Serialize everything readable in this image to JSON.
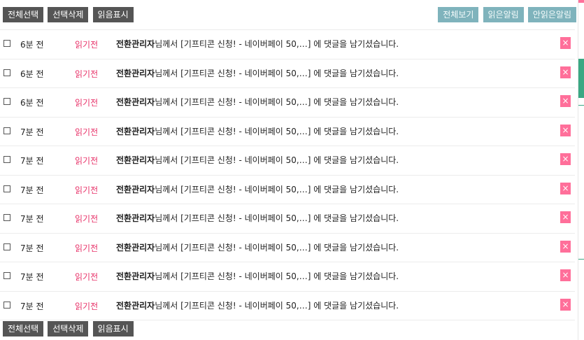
{
  "toolbar": {
    "select_all": "전체선택",
    "delete_selected": "선택삭제",
    "mark_read": "읽음표시",
    "view_all": "전체보기",
    "read_alerts": "읽은알림",
    "unread_alerts": "안읽은알림"
  },
  "notifications": [
    {
      "time": "6분 전",
      "status": "읽기전",
      "author": "전환관리자",
      "text": "님께서 [기프티콘 신청! - 네이버페이 50,…] 에 댓글을 남기셨습니다.",
      "delete": "×"
    },
    {
      "time": "6분 전",
      "status": "읽기전",
      "author": "전환관리자",
      "text": "님께서 [기프티콘 신청! - 네이버페이 50,…] 에 댓글을 남기셨습니다.",
      "delete": "×"
    },
    {
      "time": "6분 전",
      "status": "읽기전",
      "author": "전환관리자",
      "text": "님께서 [기프티콘 신청! - 네이버페이 50,…] 에 댓글을 남기셨습니다.",
      "delete": "×"
    },
    {
      "time": "7분 전",
      "status": "읽기전",
      "author": "전환관리자",
      "text": "님께서 [기프티콘 신청! - 네이버페이 50,…] 에 댓글을 남기셨습니다.",
      "delete": "×"
    },
    {
      "time": "7분 전",
      "status": "읽기전",
      "author": "전환관리자",
      "text": "님께서 [기프티콘 신청! - 네이버페이 50,…] 에 댓글을 남기셨습니다.",
      "delete": "×"
    },
    {
      "time": "7분 전",
      "status": "읽기전",
      "author": "전환관리자",
      "text": "님께서 [기프티콘 신청! - 네이버페이 50,…] 에 댓글을 남기셨습니다.",
      "delete": "×"
    },
    {
      "time": "7분 전",
      "status": "읽기전",
      "author": "전환관리자",
      "text": "님께서 [기프티콘 신청! - 네이버페이 50,…] 에 댓글을 남기셨습니다.",
      "delete": "×"
    },
    {
      "time": "7분 전",
      "status": "읽기전",
      "author": "전환관리자",
      "text": "님께서 [기프티콘 신청! - 네이버페이 50,…] 에 댓글을 남기셨습니다.",
      "delete": "×"
    },
    {
      "time": "7분 전",
      "status": "읽기전",
      "author": "전환관리자",
      "text": "님께서 [기프티콘 신청! - 네이버페이 50,…] 에 댓글을 남기셨습니다.",
      "delete": "×"
    },
    {
      "time": "7분 전",
      "status": "읽기전",
      "author": "전환관리자",
      "text": "님께서 [기프티콘 신청! - 네이버페이 50,…] 에 댓글을 남기셨습니다.",
      "delete": "×"
    }
  ],
  "icons": {
    "checkbox": "checkbox-icon",
    "delete": "close-icon"
  },
  "colors": {
    "dark_button": "#555555",
    "teal_button": "#7fb3bc",
    "unread": "#e8356b",
    "delete_bg": "#ff6f9a"
  }
}
